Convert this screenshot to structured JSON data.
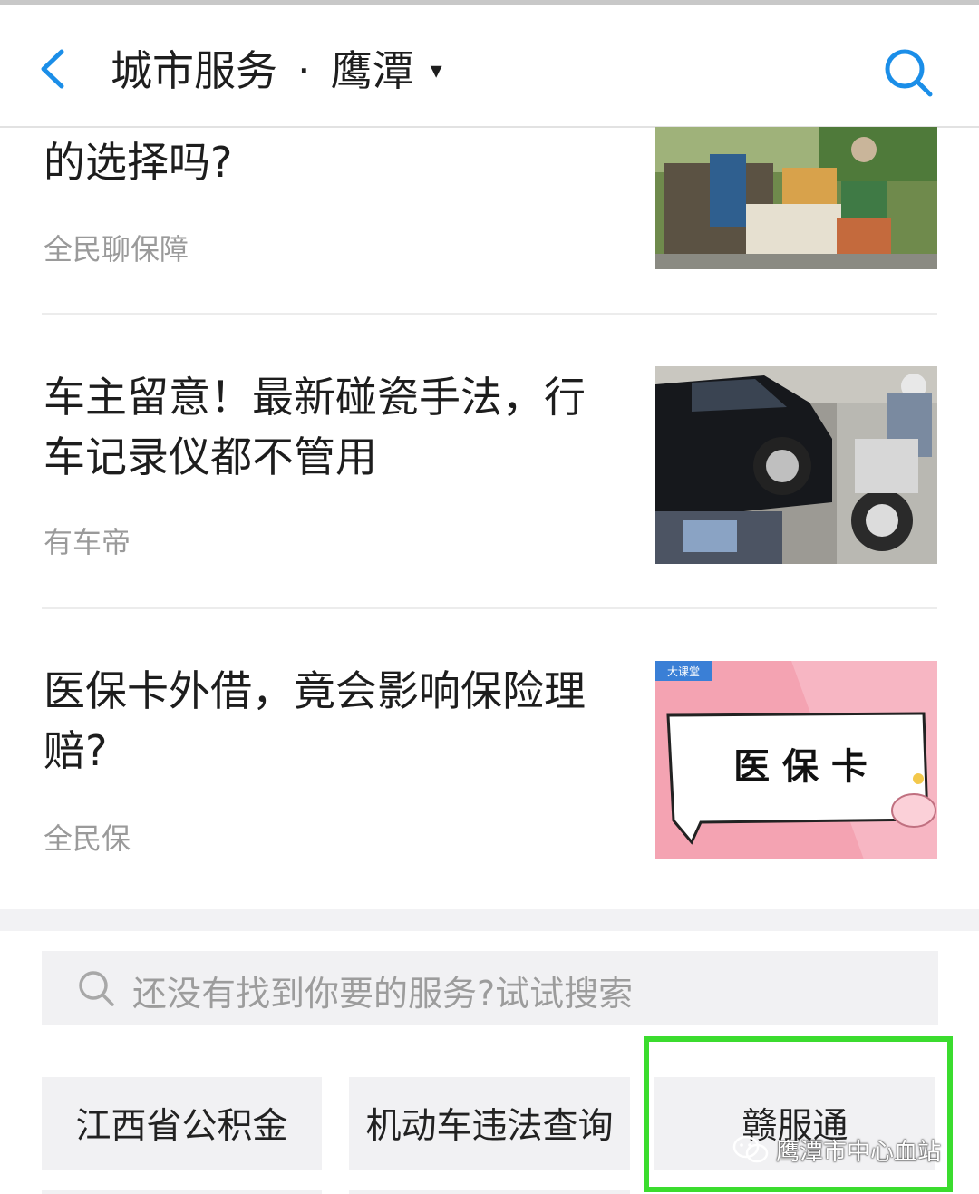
{
  "header": {
    "title": "城市服务",
    "separator": "·",
    "city": "鹰潭",
    "dropdown_glyph": "▾",
    "back_icon": "chevron-left-icon",
    "search_icon": "search-icon",
    "accent_color": "#1b8ee8"
  },
  "articles": [
    {
      "title": "的选择吗?",
      "source": "全民聊保障",
      "thumbnail": "market-photo"
    },
    {
      "title": "车主留意！最新碰瓷手法，行车记录仪都不管用",
      "source": "有车帝",
      "thumbnail": "car-accident-photo"
    },
    {
      "title": "医保卡外借，竟会影响保险理赔?",
      "source": "全民保",
      "thumbnail_text": "医 保 卡",
      "thumbnail_tag": "大课堂"
    }
  ],
  "search": {
    "placeholder": "还没有找到你要的服务?试试搜索"
  },
  "services": [
    {
      "label": "江西省公积金"
    },
    {
      "label": "机动车违法查询"
    },
    {
      "label": "赣服通"
    }
  ],
  "highlight_color": "#3bdc2e",
  "watermark": {
    "text": "鹰潭市中心血站",
    "icon": "wechat-icon"
  }
}
